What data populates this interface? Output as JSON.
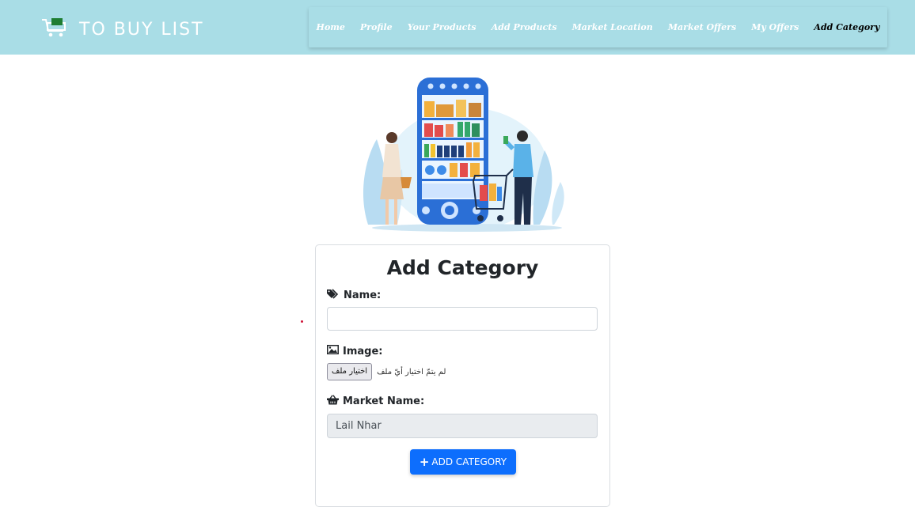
{
  "app": {
    "title": "TO BUY LIST"
  },
  "nav": {
    "items": [
      {
        "label": "Home"
      },
      {
        "label": "Profile"
      },
      {
        "label": "Your Products"
      },
      {
        "label": "Add Products"
      },
      {
        "label": "Market Location"
      },
      {
        "label": "Market Offers"
      },
      {
        "label": "My Offers"
      },
      {
        "label": "Add Category"
      }
    ],
    "active": "Add Category"
  },
  "form": {
    "title": "Add Category",
    "name_label": "Name:",
    "name_value": "",
    "image_label": "Image:",
    "file_button": "اختيار ملف",
    "file_status": "لم يتمّ اختيار أيّ ملف",
    "market_label": "Market Name:",
    "market_value": "Lail Nhar",
    "submit_label": "ADD CATEGORY"
  },
  "colors": {
    "header_bg": "#a9dde6",
    "primary_button": "#0d6efd",
    "cart_green": "#1e7d32"
  },
  "icons": [
    "cart-icon",
    "tags-icon",
    "image-icon",
    "basket-icon",
    "plus-icon"
  ]
}
